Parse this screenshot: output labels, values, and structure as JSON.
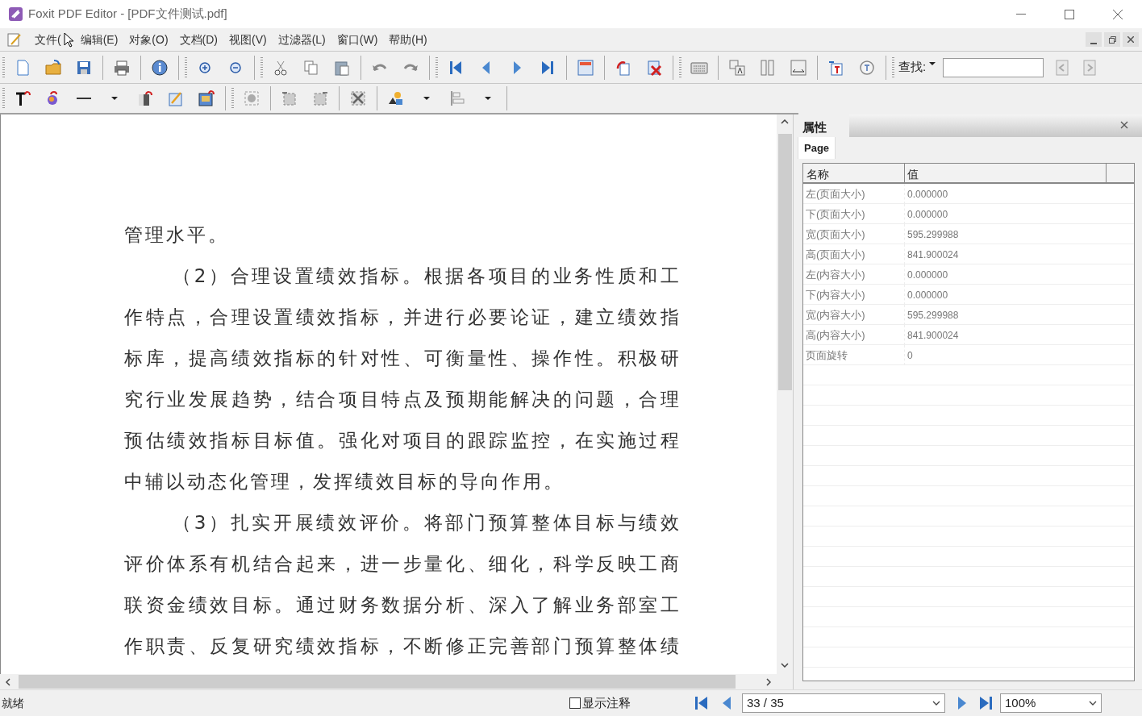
{
  "window": {
    "title": "Foxit PDF Editor - [PDF文件测试.pdf]"
  },
  "menu": [
    "文件(",
    "编辑(E)",
    "对象(O)",
    "文档(D)",
    "视图(V)",
    "过滤器(L)",
    "窗口(W)",
    "帮助(H)"
  ],
  "search": {
    "label": "查找:"
  },
  "document": {
    "lines": [
      {
        "text": "管理水平。",
        "indent": false,
        "kind": "plain"
      },
      {
        "text": "（2）合理设置绩效指标。根据各项目的业务性质和工",
        "indent": true,
        "kind": "full"
      },
      {
        "text": "作特点，合理设置绩效指标，并进行必要论证，建立绩效指",
        "indent": false,
        "kind": "full"
      },
      {
        "text": "标库，提高绩效指标的针对性、可衡量性、操作性。积极研",
        "indent": false,
        "kind": "full"
      },
      {
        "text": "究行业发展趋势，结合项目特点及预期能解决的问题，合理",
        "indent": false,
        "kind": "full"
      },
      {
        "text": "预估绩效指标目标值。强化对项目的跟踪监控，在实施过程",
        "indent": false,
        "kind": "full"
      },
      {
        "text": "中辅以动态化管理，发挥绩效目标的导向作用。",
        "indent": false,
        "kind": "plain"
      },
      {
        "text": "（3）扎实开展绩效评价。将部门预算整体目标与绩效",
        "indent": true,
        "kind": "full"
      },
      {
        "text": "评价体系有机结合起来，进一步量化、细化，科学反映工商",
        "indent": false,
        "kind": "full"
      },
      {
        "text": "联资金绩效目标。通过财务数据分析、深入了解业务部室工",
        "indent": false,
        "kind": "full"
      },
      {
        "text": "作职责、反复研究绩效指标，不断修正完善部门预算整体绩",
        "indent": false,
        "kind": "full"
      }
    ]
  },
  "properties": {
    "title": "属性",
    "tabs": [
      {
        "label": "Page",
        "selected": true
      }
    ],
    "columns": [
      "名称",
      "值"
    ],
    "rows": [
      {
        "name": "左(页面大小)",
        "value": "0.000000"
      },
      {
        "name": "下(页面大小)",
        "value": "0.000000"
      },
      {
        "name": "宽(页面大小)",
        "value": "595.299988"
      },
      {
        "name": "高(页面大小)",
        "value": "841.900024"
      },
      {
        "name": "左(内容大小)",
        "value": "0.000000"
      },
      {
        "name": "下(内容大小)",
        "value": "0.000000"
      },
      {
        "name": "宽(内容大小)",
        "value": "595.299988"
      },
      {
        "name": "高(内容大小)",
        "value": "841.900024"
      },
      {
        "name": "页面旋转",
        "value": "0"
      }
    ]
  },
  "status_bar": {
    "text": "就绪",
    "show_annotations": {
      "label": "显示注释",
      "checked": false
    },
    "page": "33 / 35",
    "zoom": "100%"
  }
}
